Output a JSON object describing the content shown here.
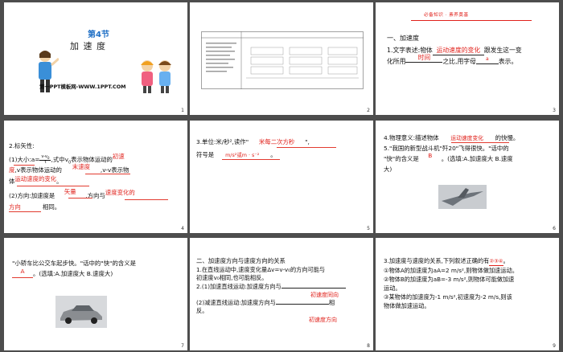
{
  "slides": [
    {
      "num": "1",
      "title_small": "第4节",
      "title_big": "加  速  度",
      "footer": "第一PPT模板网-WWW.1PPT.COM"
    },
    {
      "num": "2",
      "table": [
        [
          "课程标准",
          "素养目标"
        ],
        [
          "1.理解加速度的物理意义。",
          "能区分速度、速度变化量和速度变化率"
        ],
        [
          "2.会用 Δv/Δt 计算。",
          "",
          "运用比值定义法"
        ],
        [
          "",
          "",
          "能用 v-t 图像"
        ],
        [
          "",
          "物理观念",
          "科学思维",
          "科学探究",
          "科学态度"
        ]
      ]
    },
    {
      "num": "3",
      "banner": "必备知识 · 素养奠基",
      "h1": "一、加速度",
      "l1": "1.文字表述:物体",
      "b1": "运动速度的变化",
      "l1b": "跟发生这一变",
      "l2": "化所用",
      "b2": "时间",
      "l2b": "之比,用字母",
      "b3": "a",
      "l2c": "表示。"
    },
    {
      "num": "4",
      "h": "2.标矢性:",
      "l1a": "(1)大小:a=",
      "frac": [
        "v",
        "t",
        "0"
      ],
      "l1b": ",式中v",
      "l1c": "表示物体运动的",
      "b1": "初速",
      "l2a": "度",
      "l2b": ",v",
      "l2c": "表示物体运动的",
      "b2": "末速度",
      "l2d": ",v",
      "l2e": "-v",
      "l2f": "表示物",
      "l3a": "体",
      "b3": "运动速度的变化",
      "l3b": "。",
      "l4a": "(2)方向:加速度是",
      "b4": "矢量",
      "l4b": ",方向与",
      "b5": "速度变化的",
      "l5a": "方向",
      "l5b": "相同。"
    },
    {
      "num": "5",
      "l1a": "3.单位:米/秒²,读作\"",
      "b1": "米每二次方秒",
      "l1b": "\",",
      "l2a": "符号是",
      "b2": "m/s²或m · s⁻²",
      "l2b": "。"
    },
    {
      "num": "6",
      "l1a": "4.物理意义:描述物体",
      "b1": "运动速度变化",
      "l1b": "的快慢。",
      "l2": "5.\"我国的新型战斗机\"歼20\"飞得很快。\"话中的",
      "l3a": "\"快\"的含义是",
      "b2": "B",
      "l3b": "。(选填:A.加速度大  B.速度",
      "l4": "大)"
    },
    {
      "num": "7",
      "l1": "\"小轿车比公交车起步快。\"话中的\"快\"的含义是",
      "b1": "A",
      "l2": "。(选填:A.加速度大  B.速度大)"
    },
    {
      "num": "8",
      "h": "二、加速度方向与速度方向的关系",
      "l1": "1.在直线运动中,速度变化量Δv=v-v₀的方向可能与",
      "l2": "初速度v₀相同,也可能相反。",
      "l3": "2.(1)加速直线运动:加速度方向与",
      "l4": "(2)减速直线运动:加速度方向与",
      "b1": "初速度同向",
      "l4b": "相",
      "l5": "反。",
      "b2": "初速度方向"
    },
    {
      "num": "9",
      "l1a": "3.加速度与速度的关系,下列叙述正确的有",
      "b1": "②③④",
      "l1b": "。",
      "l2": "①物体A的加速度为aA=2 m/s²,则物体做加速运动。",
      "l3": "②物体B的加速度为aB=-3 m/s²,则物体可能做加速",
      "l4": "运动。",
      "l5": "③某物体的加速度为-1 m/s²,初速度为-2 m/s,则该",
      "l6": "物体做加速运动。"
    }
  ],
  "colors": {
    "red": "#e0211b",
    "bg": "#4d4d4d",
    "underline_red": "#e23b30"
  }
}
